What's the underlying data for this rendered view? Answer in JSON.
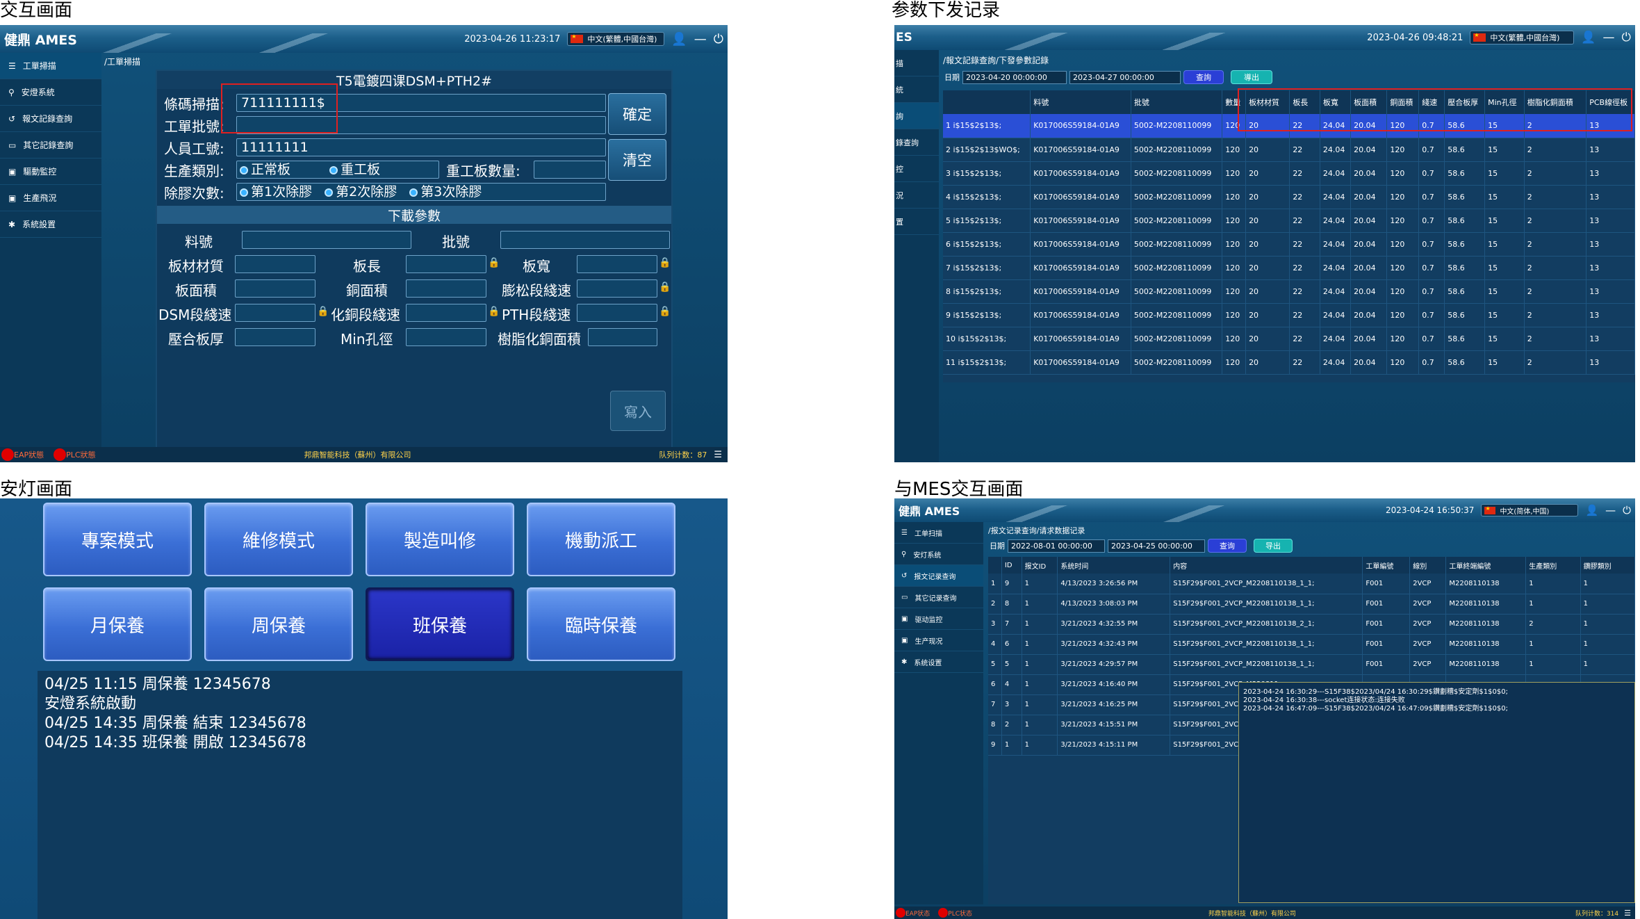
{
  "titles": {
    "interaction": "交互画面",
    "param_record": "参数下发记录",
    "andon": "安灯画面",
    "mes_interaction": "与MES交互画面"
  },
  "colors": {
    "accent_blue": "#3b6fd6",
    "status_red": "#e00000",
    "header_blue": "#1c5f8a",
    "highlight_row": "#2a4fd6"
  },
  "p1": {
    "logo": "健鼎 AMES",
    "datetime": "2023-04-26 11:23:17",
    "lang": "中文(繁體,中國台灣)",
    "breadcrumb": "/工單掃描",
    "sidebar": [
      "工單掃描",
      "安燈系統",
      "報文記錄查詢",
      "其它記錄查詢",
      "驅動監控",
      "生產飛況",
      "系統設置"
    ],
    "form_title": "T5電鍍四课DSM+PTH2#",
    "barcode_label": "條碼掃描:",
    "barcode_value": "711111111$",
    "workorder_label": "工單批號:",
    "operator_label": "人員工號:",
    "operator_value": "11111111",
    "ptype_label": "生產類別:",
    "ptype_opt1": "正常板",
    "ptype_opt2": "重工板",
    "rework_label": "重工板數量:",
    "degum_label": "除膠次數:",
    "degum_opt1": "第1次除膠",
    "degum_opt2": "第2次除膠",
    "degum_opt3": "第3次除膠",
    "confirm": "確定",
    "clear": "清空",
    "download_header": "下載參數",
    "material_label": "料號",
    "batch_label": "批號",
    "params": [
      [
        "板材材質",
        "板長",
        "板寬"
      ],
      [
        "板面積",
        "銅面積",
        "膨松段綫速"
      ],
      [
        "DSM段綫速",
        "化銅段綫速",
        "PTH段綫速"
      ],
      [
        "壓合板厚",
        "Min孔徑",
        "樹脂化銅面積"
      ]
    ],
    "write": "寫入",
    "eap": "EAP狀態",
    "plc": "PLC狀態",
    "company": "邦鼎智能科技（蘇州）有限公司",
    "queue": "队列计数：87"
  },
  "p2": {
    "logo": "ES",
    "datetime": "2023-04-26 09:48:21",
    "lang": "中文(繁體,中國台灣)",
    "breadcrumb": "/報文記錄查詢/下發參數記錄",
    "date_label": "日期",
    "date_from": "2023-04-20 00:00:00",
    "date_to": "2023-04-27 00:00:00",
    "query": "查詢",
    "export": "導出",
    "side_frag": [
      "描",
      "統",
      "詢",
      "錄查詢",
      "控",
      "況",
      "置"
    ],
    "columns": [
      "",
      "料號",
      "批號",
      "數量",
      "板材材質",
      "板長",
      "板寬",
      "板面積",
      "銅面積",
      "綫速",
      "壓合板厚",
      "Min孔徑",
      "樹脂化銅面積",
      "PCB線徑板"
    ],
    "rows": [
      [
        "1 i$15$2$13$;",
        "K017006S59184-01A9",
        "5002-M2208110099",
        "120",
        "20",
        "22",
        "24.04",
        "20.04",
        "120",
        "0.7",
        "58.6",
        "15",
        "2",
        "13"
      ],
      [
        "2 i$15$2$13$WO$;",
        "K017006S59184-01A9",
        "5002-M2208110099",
        "120",
        "20",
        "22",
        "24.04",
        "20.04",
        "120",
        "0.7",
        "58.6",
        "15",
        "2",
        "13"
      ],
      [
        "3 i$15$2$13$;",
        "K017006S59184-01A9",
        "5002-M2208110099",
        "120",
        "20",
        "22",
        "24.04",
        "20.04",
        "120",
        "0.7",
        "58.6",
        "15",
        "2",
        "13"
      ],
      [
        "4 i$15$2$13$;",
        "K017006S59184-01A9",
        "5002-M2208110099",
        "120",
        "20",
        "22",
        "24.04",
        "20.04",
        "120",
        "0.7",
        "58.6",
        "15",
        "2",
        "13"
      ],
      [
        "5 i$15$2$13$;",
        "K017006S59184-01A9",
        "5002-M2208110099",
        "120",
        "20",
        "22",
        "24.04",
        "20.04",
        "120",
        "0.7",
        "58.6",
        "15",
        "2",
        "13"
      ],
      [
        "6 i$15$2$13$;",
        "K017006S59184-01A9",
        "5002-M2208110099",
        "120",
        "20",
        "22",
        "24.04",
        "20.04",
        "120",
        "0.7",
        "58.6",
        "15",
        "2",
        "13"
      ],
      [
        "7 i$15$2$13$;",
        "K017006S59184-01A9",
        "5002-M2208110099",
        "120",
        "20",
        "22",
        "24.04",
        "20.04",
        "120",
        "0.7",
        "58.6",
        "15",
        "2",
        "13"
      ],
      [
        "8 i$15$2$13$;",
        "K017006S59184-01A9",
        "5002-M2208110099",
        "120",
        "20",
        "22",
        "24.04",
        "20.04",
        "120",
        "0.7",
        "58.6",
        "15",
        "2",
        "13"
      ],
      [
        "9 i$15$2$13$;",
        "K017006S59184-01A9",
        "5002-M2208110099",
        "120",
        "20",
        "22",
        "24.04",
        "20.04",
        "120",
        "0.7",
        "58.6",
        "15",
        "2",
        "13"
      ],
      [
        "10 i$15$2$13$;",
        "K017006S59184-01A9",
        "5002-M2208110099",
        "120",
        "20",
        "22",
        "24.04",
        "20.04",
        "120",
        "0.7",
        "58.6",
        "15",
        "2",
        "13"
      ],
      [
        "11 i$15$2$13$;",
        "K017006S59184-01A9",
        "5002-M2208110099",
        "120",
        "20",
        "22",
        "24.04",
        "20.04",
        "120",
        "0.7",
        "58.6",
        "15",
        "2",
        "13"
      ]
    ]
  },
  "p3": {
    "buttons": [
      "專案模式",
      "維修模式",
      "製造叫修",
      "機動派工",
      "月保養",
      "周保養",
      "班保養",
      "臨時保養"
    ],
    "active_index": 6,
    "log": [
      "04/25 11:15 周保養 12345678",
      "安燈系統啟動",
      "04/25 14:35 周保養 結束 12345678",
      "04/25 14:35 班保養 開啟 12345678"
    ]
  },
  "p4": {
    "logo": "健鼎 AMES",
    "datetime": "2023-04-24 16:50:37",
    "lang": "中文(简体,中国)",
    "breadcrumb": "/报文记录查询/请求数据记录",
    "date_label": "日期",
    "date_from": "2022-08-01 00:00:00",
    "date_to": "2023-04-25 00:00:00",
    "query": "查询",
    "export": "导出",
    "sidebar": [
      "工单扫描",
      "安灯系统",
      "报文记录查询",
      "其它记录查询",
      "驱动监控",
      "生产现况",
      "系统设置"
    ],
    "columns": [
      "",
      "ID",
      "报文ID",
      "系统时间",
      "内容",
      "工單編號",
      "線別",
      "工單終端編號",
      "生產類別",
      "鑽膠類別"
    ],
    "rows": [
      [
        "1",
        "9",
        "1",
        "4/13/2023 3:26:56 PM",
        "S15F29$F001_2VCP_M2208110138_1_1;",
        "F001",
        "2VCP",
        "M2208110138",
        "1",
        "1"
      ],
      [
        "2",
        "8",
        "1",
        "4/13/2023 3:08:03 PM",
        "S15F29$F001_2VCP_M2208110138_1_1;",
        "F001",
        "2VCP",
        "M2208110138",
        "1",
        "1"
      ],
      [
        "3",
        "7",
        "1",
        "3/21/2023 4:32:55 PM",
        "S15F29$F001_2VCP_M2208110138_2_1;",
        "F001",
        "2VCP",
        "M2208110138",
        "2",
        "1"
      ],
      [
        "4",
        "6",
        "1",
        "3/21/2023 4:32:43 PM",
        "S15F29$F001_2VCP_M2208110138_1_1;",
        "F001",
        "2VCP",
        "M2208110138",
        "1",
        "1"
      ],
      [
        "5",
        "5",
        "1",
        "3/21/2023 4:29:57 PM",
        "S15F29$F001_2VCP_M2208110138_1_1;",
        "F001",
        "2VCP",
        "M2208110138",
        "1",
        "1"
      ],
      [
        "6",
        "4",
        "1",
        "3/21/2023 4:16:40 PM",
        "S15F29$F001_2VCP_M220811",
        "",
        "",
        "",
        "",
        ""
      ],
      [
        "7",
        "3",
        "1",
        "3/21/2023 4:16:25 PM",
        "S15F29$F001_2VCP_M220811",
        "",
        "",
        "",
        "",
        ""
      ],
      [
        "8",
        "2",
        "1",
        "3/21/2023 4:15:51 PM",
        "S15F29$F001_2VCP_M220811",
        "",
        "",
        "",
        "",
        ""
      ],
      [
        "9",
        "1",
        "1",
        "3/21/2023 4:15:11 PM",
        "S15F29$F001_2VCP_M220811",
        "",
        "",
        "",
        "",
        ""
      ]
    ],
    "popup": [
      "2023-04-24 16:30:29---S15F38$2023/04/24 16:30:29$鑽劃糟$安定劑$1$0$0;",
      "2023-04-24 16:30:38---socket连接状态:连接失败",
      "2023-04-24 16:47:09---S15F38$2023/04/24 16:47:09$鑽劃糟$安定劑$1$0$0;"
    ],
    "eap": "EAP状态",
    "plc": "PLC状态",
    "company": "邦鼎智能科技（蘇州）有限公司",
    "queue": "队列计数：314"
  }
}
